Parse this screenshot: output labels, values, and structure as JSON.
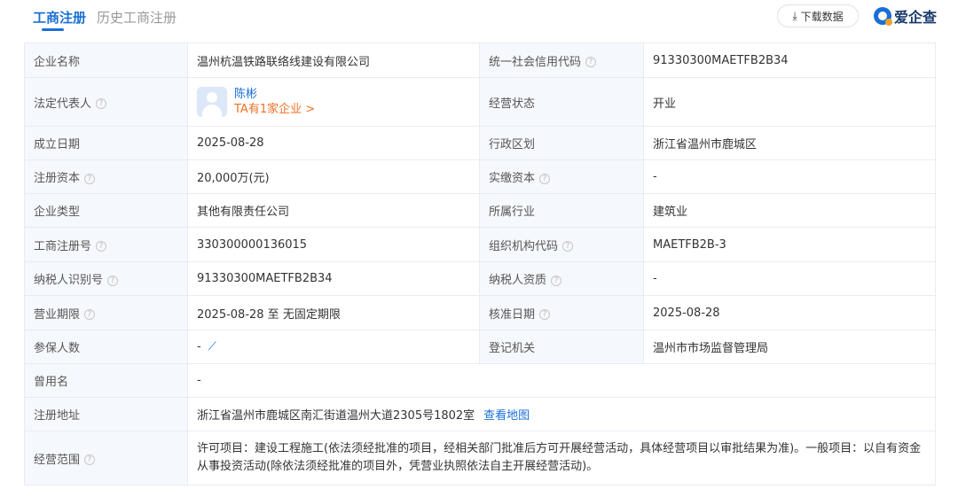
{
  "tabs": [
    {
      "label": "工商注册"
    },
    {
      "label": "历史工商注册"
    }
  ],
  "toolbar": {
    "download_label": "下载数据",
    "logo_text": "爱企查"
  },
  "rows": [
    {
      "l1": "企业名称",
      "v1": "温州杭温铁路联络线建设有限公司",
      "l2": "统一社会信用代码",
      "v2": "91330300MAETFB2B34"
    },
    {
      "l1": "法定代表人",
      "v1": "陈彬",
      "v1_sub": "TA有1家企业 >",
      "l2": "经营状态",
      "v2": "开业"
    },
    {
      "l1": "成立日期",
      "v1": "2025-08-28",
      "l2": "行政区划",
      "v2": "浙江省温州市鹿城区"
    },
    {
      "l1": "注册资本",
      "v1": "20,000万(元)",
      "l2": "实缴资本",
      "v2": "-"
    },
    {
      "l1": "企业类型",
      "v1": "其他有限责任公司",
      "l2": "所属行业",
      "v2": "建筑业"
    },
    {
      "l1": "工商注册号",
      "v1": "330300000136015",
      "l2": "组织机构代码",
      "v2": "MAETFB2B-3"
    },
    {
      "l1": "纳税人识别号",
      "v1": "91330300MAETFB2B34",
      "l2": "纳税人资质",
      "v2": "-"
    },
    {
      "l1": "营业期限",
      "v1": "2025-08-28 至 无固定期限",
      "l2": "核准日期",
      "v2": "2025-08-28"
    },
    {
      "l1": "参保人数",
      "v1": "-",
      "l2": "登记机关",
      "v2": "温州市市场监督管理局"
    },
    {
      "l1": "曾用名",
      "v1": "-"
    },
    {
      "l1": "注册地址",
      "v1": "浙江省温州市鹿城区南汇街道温州大道2305号1802室",
      "v1_link": "查看地图"
    },
    {
      "l1": "经营范围",
      "v1": "许可项目：建设工程施工(依法须经批准的项目，经相关部门批准后方可开展经营活动，具体经营项目以审批结果为准)。一般项目：以自有资金从事投资活动(除依法须经批准的项目外，凭营业执照依法自主开展经营活动)。"
    }
  ],
  "icons": {
    "help": "question-circle-icon",
    "download": "download-arrow-icon",
    "trend": "trend-chart-icon",
    "avatar": "person-avatar-icon"
  },
  "colors": {
    "accent": "#1a6fd6",
    "link_orange": "#f07022",
    "label_bg": "#f5f8fc"
  }
}
